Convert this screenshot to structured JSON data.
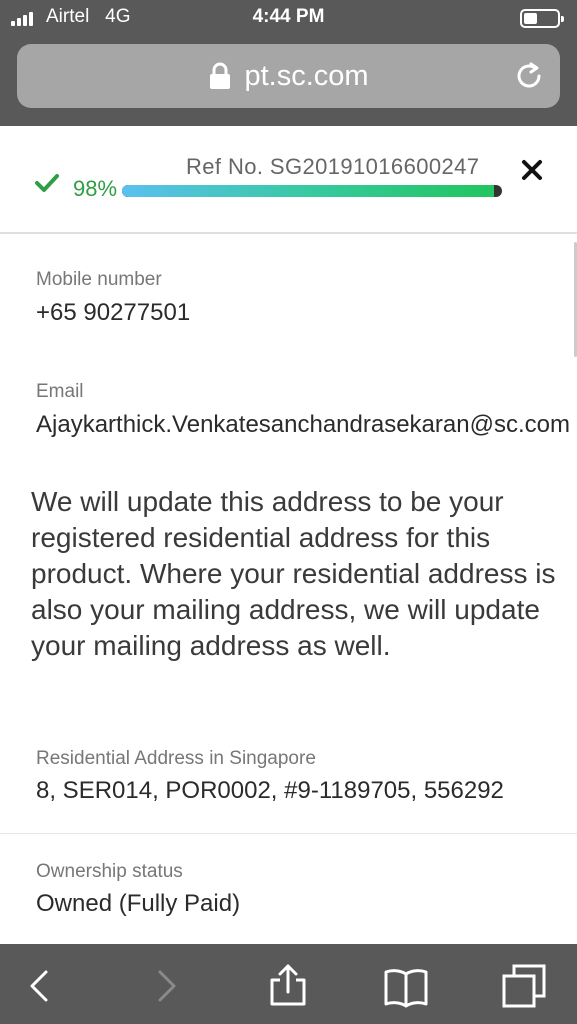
{
  "status_bar": {
    "carrier": "Airtel",
    "network": "4G",
    "time": "4:44 PM"
  },
  "browser": {
    "url": "pt.sc.com",
    "icons": [
      "lock-icon",
      "reload-icon"
    ]
  },
  "progress": {
    "ref_label": "Ref No. SG20191016600247",
    "percent_text": "98%",
    "percent_value": 98,
    "accent": "#22c55e",
    "icons": [
      "checkmark-icon",
      "close-icon"
    ]
  },
  "fields": {
    "mobile_label": "Mobile number",
    "mobile_value": "+65 90277501",
    "email_label": "Email",
    "email_value": "Ajaykarthick.Venkatesanchandrasekaran@sc.com",
    "notice": "We will update this address to be your registered residential address for this product. Where your residential address is also your mailing address, we will update your mailing address as well.",
    "address_label": "Residential Address in Singapore",
    "address_value": "8, SER014, POR0002, #9-1189705, 556292",
    "ownership_label": "Ownership status",
    "ownership_value": "Owned (Fully Paid)"
  },
  "toolbar": {
    "icons": [
      "back-icon",
      "forward-icon",
      "share-icon",
      "bookmarks-icon",
      "tabs-icon"
    ]
  }
}
